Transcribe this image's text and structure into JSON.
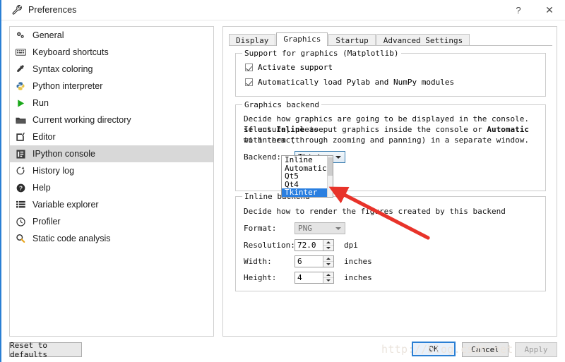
{
  "window": {
    "title": "Preferences",
    "title_icon": "wrench-icon",
    "help_button": "?",
    "close_button": "✕"
  },
  "sidebar": {
    "items": [
      {
        "label": "General",
        "icon": "gears-icon",
        "selected": false
      },
      {
        "label": "Keyboard shortcuts",
        "icon": "keyboard-icon",
        "selected": false
      },
      {
        "label": "Syntax coloring",
        "icon": "eyedropper-icon",
        "selected": false
      },
      {
        "label": "Python interpreter",
        "icon": "python-icon",
        "selected": false
      },
      {
        "label": "Run",
        "icon": "play-icon",
        "selected": false
      },
      {
        "label": "Current working directory",
        "icon": "folder-icon",
        "selected": false
      },
      {
        "label": "Editor",
        "icon": "pencil-square-icon",
        "selected": false
      },
      {
        "label": "IPython console",
        "icon": "console-icon",
        "selected": true
      },
      {
        "label": "History log",
        "icon": "history-icon",
        "selected": false
      },
      {
        "label": "Help",
        "icon": "question-circle-icon",
        "selected": false
      },
      {
        "label": "Variable explorer",
        "icon": "table-icon",
        "selected": false
      },
      {
        "label": "Profiler",
        "icon": "clock-icon",
        "selected": false
      },
      {
        "label": "Static code analysis",
        "icon": "magnifier-icon",
        "selected": false
      }
    ]
  },
  "tabs": [
    {
      "label": "Display",
      "active": false
    },
    {
      "label": "Graphics",
      "active": true
    },
    {
      "label": "Startup",
      "active": false
    },
    {
      "label": "Advanced Settings",
      "active": false
    }
  ],
  "support_group": {
    "title": "Support for graphics (Matplotlib)",
    "checkboxes": [
      {
        "label": "Activate support",
        "checked": true
      },
      {
        "label": "Automatically load Pylab and NumPy modules",
        "checked": true
      }
    ]
  },
  "backend_group": {
    "title": "Graphics backend",
    "description_1": "Decide how graphics are going to be displayed in the console. If unsure, please",
    "description_2a": "select ",
    "description_2b": "Inline",
    "description_2c": " to put graphics inside the console or ",
    "description_2d": "Automatic",
    "description_2e": " to interact",
    "description_3": "with them (through zooming and panning) in a separate window.",
    "field_label": "Backend:",
    "value": "Tkinter",
    "options": [
      "Inline",
      "Automatic",
      "Qt5",
      "Qt4",
      "Tkinter"
    ],
    "selected_option": "Tkinter"
  },
  "inline_group": {
    "title": "Inline backend",
    "description": "Decide how to render the figures created by this backend",
    "format": {
      "label": "Format:",
      "value": "PNG",
      "disabled": true
    },
    "resolution": {
      "label": "Resolution:",
      "value": "72.0",
      "unit": "dpi"
    },
    "width": {
      "label": "Width:",
      "value": "6",
      "unit": "inches"
    },
    "height": {
      "label": "Height:",
      "value": "4",
      "unit": "inches"
    }
  },
  "footer": {
    "reset_label": "Reset to defaults",
    "ok_label": "OK",
    "cancel_label": "Cancel",
    "apply_label": "Apply",
    "watermark": "http://blog.csdn.net"
  },
  "colors": {
    "accent": "#2a7fd4",
    "selection": "#2a7fe0",
    "annotation_arrow": "#e8332a",
    "sidebar_selected": "#d8d8d8"
  }
}
